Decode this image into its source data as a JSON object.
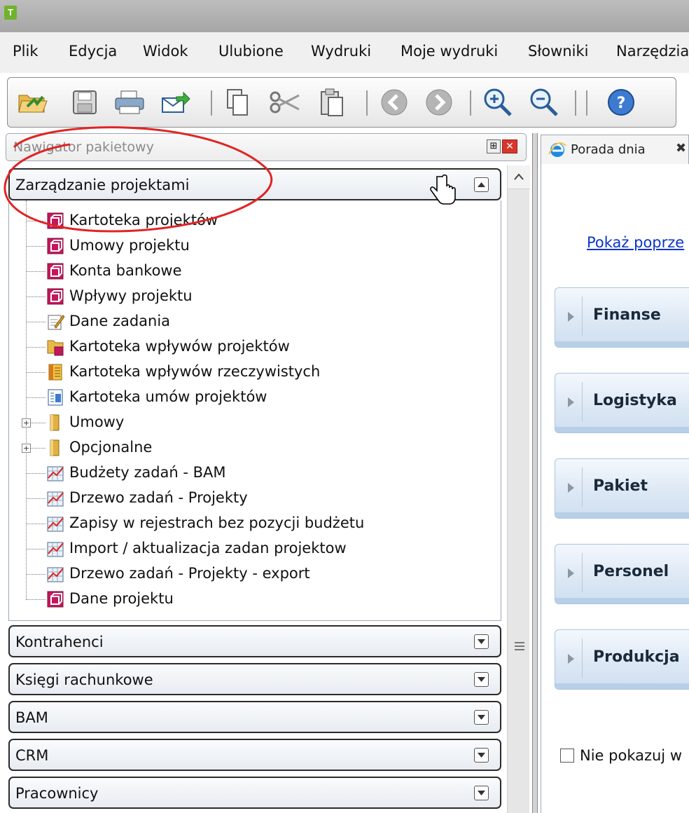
{
  "titlebar": {
    "app_icon": "T"
  },
  "menu": {
    "items": [
      "Plik",
      "Edycja",
      "Widok",
      "Ulubione",
      "Wydruki",
      "Moje wydruki",
      "Słowniki",
      "Narzędzia"
    ]
  },
  "toolbar": {
    "buttons": [
      "open-folder-icon",
      "save-icon",
      "print-icon",
      "send-icon",
      "copy-icon",
      "cut-icon",
      "paste-icon",
      "back-icon",
      "forward-icon",
      "zoom-in-icon",
      "zoom-out-icon",
      "help-icon"
    ]
  },
  "navigator": {
    "title": "Nawigator pakietowy",
    "active_section": "Zarządzanie projektami",
    "tree": [
      {
        "label": "Kartoteka projektów",
        "icon": "form-icon"
      },
      {
        "label": "Umowy projektu",
        "icon": "form-icon"
      },
      {
        "label": "Konta bankowe",
        "icon": "form-icon"
      },
      {
        "label": "Wpływy projektu",
        "icon": "form-icon"
      },
      {
        "label": "Dane zadania",
        "icon": "edit-document-icon"
      },
      {
        "label": "Kartoteka wpływów projektów",
        "icon": "folder-form-icon"
      },
      {
        "label": "Kartoteka wpływów rzeczywistych",
        "icon": "ledger-icon"
      },
      {
        "label": "Kartoteka umów projektów",
        "icon": "contract-list-icon"
      },
      {
        "label": "Umowy",
        "icon": "folder-icon"
      },
      {
        "label": "Opcjonalne",
        "icon": "folder-icon"
      },
      {
        "label": "Budżety zadań - BAM",
        "icon": "chart-icon"
      },
      {
        "label": "Drzewo zadań - Projekty",
        "icon": "chart-icon"
      },
      {
        "label": "Zapisy w rejestrach bez pozycji budżetu",
        "icon": "chart-icon"
      },
      {
        "label": "Import / aktualizacja zadan projektow",
        "icon": "chart-icon"
      },
      {
        "label": "Drzewo zadań - Projekty - export",
        "icon": "chart-icon"
      },
      {
        "label": "Dane projektu",
        "icon": "form-icon"
      }
    ],
    "sections": [
      "Kontrahenci",
      "Księgi rachunkowe",
      "BAM",
      "CRM",
      "Pracownicy"
    ]
  },
  "right_panel": {
    "tab_label": "Porada dnia",
    "link": "Pokaż poprze",
    "categories": [
      "Finanse",
      "Logistyka",
      "Pakiet",
      "Personel",
      "Produkcja"
    ],
    "checkbox_label": "Nie pokazuj w"
  }
}
